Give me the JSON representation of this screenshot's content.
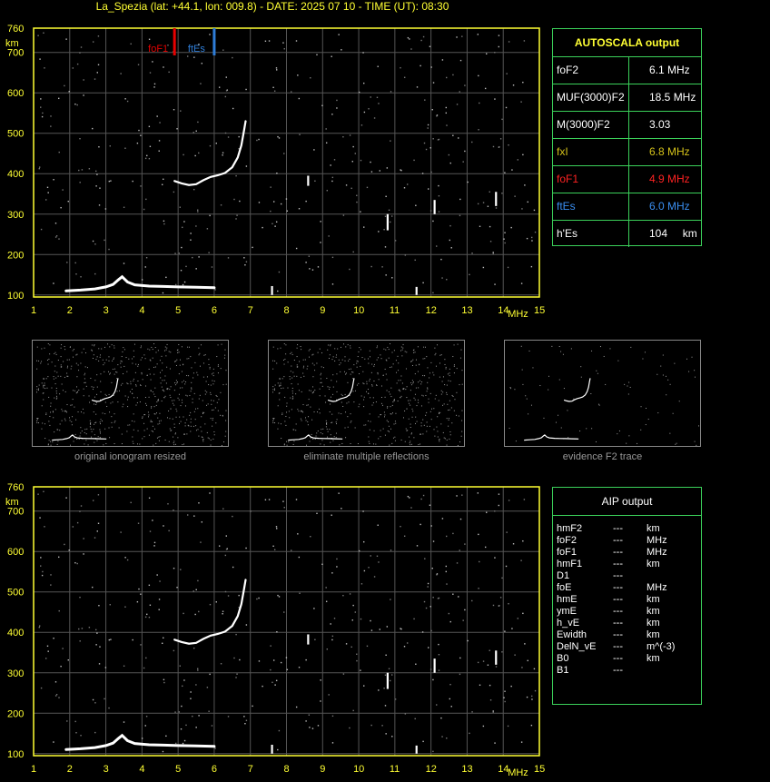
{
  "header": {
    "title": "La_Spezia (lat: +44.1, lon: 009.8) - DATE: 2025 07 10 - TIME (UT): 08:30"
  },
  "chart_data": [
    {
      "type": "scatter",
      "title": "",
      "y_axis": {
        "label": "km",
        "ticks": [
          100,
          200,
          300,
          400,
          500,
          600,
          700,
          760
        ],
        "range": [
          95,
          760
        ]
      },
      "x_axis": {
        "label": "MHz",
        "ticks": [
          1,
          2,
          3,
          4,
          5,
          6,
          7,
          8,
          9,
          10,
          11,
          12,
          13,
          14,
          15
        ],
        "range": [
          1,
          15
        ]
      },
      "grid": true,
      "markers": [
        {
          "name": "foF1",
          "frequency_mhz": 4.9,
          "color": "#e60000"
        },
        {
          "name": "ftEs",
          "frequency_mhz": 6.0,
          "color": "#2e7dd8"
        }
      ],
      "traces": [
        {
          "kind": "F-layer trace",
          "points": [
            [
              4.9,
              382
            ],
            [
              5.1,
              376
            ],
            [
              5.3,
              372
            ],
            [
              5.5,
              374
            ],
            [
              5.7,
              384
            ],
            [
              5.9,
              392
            ],
            [
              6.1,
              396
            ],
            [
              6.3,
              402
            ],
            [
              6.5,
              416
            ],
            [
              6.65,
              440
            ],
            [
              6.75,
              470
            ],
            [
              6.82,
              505
            ],
            [
              6.87,
              530
            ]
          ]
        },
        {
          "kind": "E-layer trace",
          "points": [
            [
              1.9,
              110
            ],
            [
              2.3,
              112
            ],
            [
              2.7,
              115
            ],
            [
              3.0,
              120
            ],
            [
              3.2,
              126
            ],
            [
              3.35,
              138
            ],
            [
              3.45,
              145
            ],
            [
              3.6,
              132
            ],
            [
              3.8,
              125
            ],
            [
              4.2,
              122
            ],
            [
              4.6,
              121
            ],
            [
              5.0,
              120
            ],
            [
              5.5,
              119
            ],
            [
              6.0,
              118
            ]
          ]
        },
        {
          "kind": "vertical spikes",
          "segments": [
            [
              7.6,
              100,
              122
            ],
            [
              8.6,
              370,
              395
            ],
            [
              10.8,
              260,
              300
            ],
            [
              11.6,
              100,
              120
            ],
            [
              12.1,
              300,
              335
            ],
            [
              13.8,
              320,
              355
            ]
          ]
        }
      ]
    },
    {
      "type": "scatter",
      "title": "",
      "y_axis": {
        "label": "km",
        "ticks": [
          100,
          200,
          300,
          400,
          500,
          600,
          700,
          760
        ],
        "range": [
          95,
          760
        ]
      },
      "x_axis": {
        "label": "MHz",
        "ticks": [
          1,
          2,
          3,
          4,
          5,
          6,
          7,
          8,
          9,
          10,
          11,
          12,
          13,
          14,
          15
        ],
        "range": [
          1,
          15
        ]
      },
      "grid": true
    }
  ],
  "autoscala": {
    "title": "AUTOSCALA output",
    "rows": [
      {
        "label": "foF2",
        "value": "6.1 MHz",
        "color": "#ffffff"
      },
      {
        "label": "MUF(3000)F2",
        "value": "18.5 MHz",
        "color": "#ffffff"
      },
      {
        "label": "M(3000)F2",
        "value": "3.03",
        "color": "#ffffff"
      },
      {
        "label": "fxI",
        "value": "6.8 MHz",
        "color": "#d4c11a"
      },
      {
        "label": "foF1",
        "value": "4.9 MHz",
        "color": "#ff2222"
      },
      {
        "label": "ftEs",
        "value": "6.0 MHz",
        "color": "#3a8ef0"
      },
      {
        "label": "h'Es",
        "value": "104     km",
        "color": "#ffffff"
      }
    ]
  },
  "thumbnails": [
    {
      "caption": "original ionogram resized"
    },
    {
      "caption": "eliminate multiple reflections"
    },
    {
      "caption": "evidence F2 trace"
    }
  ],
  "aip": {
    "title": "AIP output",
    "rows": [
      {
        "name": "hmF2",
        "value": "---",
        "unit": "km"
      },
      {
        "name": "foF2",
        "value": "---",
        "unit": "MHz"
      },
      {
        "name": "foF1",
        "value": "---",
        "unit": "MHz"
      },
      {
        "name": "hmF1",
        "value": "---",
        "unit": "km"
      },
      {
        "name": "D1",
        "value": "---",
        "unit": ""
      },
      {
        "name": "foE",
        "value": "---",
        "unit": "MHz"
      },
      {
        "name": "hmE",
        "value": "---",
        "unit": "km"
      },
      {
        "name": "ymE",
        "value": "---",
        "unit": "km"
      },
      {
        "name": "h_vE",
        "value": "---",
        "unit": "km"
      },
      {
        "name": "Ewidth",
        "value": "---",
        "unit": "km"
      },
      {
        "name": "DelN_vE",
        "value": "---",
        "unit": "m^(-3)"
      },
      {
        "name": "B0",
        "value": "---",
        "unit": "km"
      },
      {
        "name": "B1",
        "value": "---",
        "unit": ""
      }
    ]
  }
}
